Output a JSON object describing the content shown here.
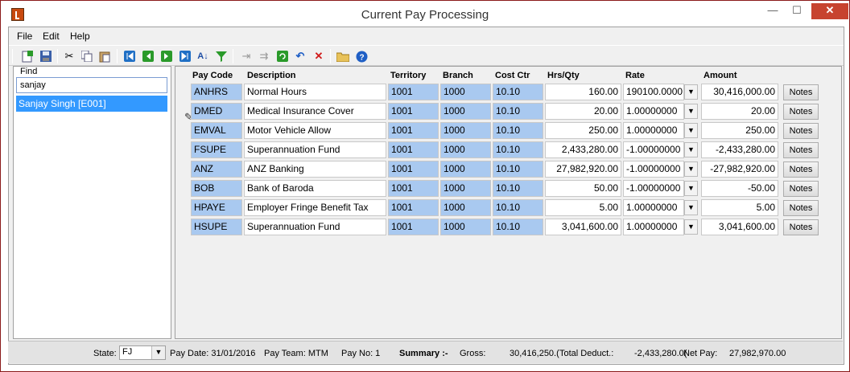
{
  "window": {
    "title": "Current Pay Processing",
    "min_glyph": "—",
    "max_glyph": "☐",
    "close_glyph": "✕"
  },
  "menu": {
    "file": "File",
    "edit": "Edit",
    "help": "Help"
  },
  "find": {
    "label": "Find",
    "value": "sanjay"
  },
  "employee": {
    "selected": "Sanjay  Singh [E001]"
  },
  "columns": {
    "pay_code": "Pay Code",
    "description": "Description",
    "territory": "Territory",
    "branch": "Branch",
    "cost_ctr": "Cost Ctr",
    "hrs_qty": "Hrs/Qty",
    "rate": "Rate",
    "amount": "Amount"
  },
  "rows": [
    {
      "code": "ANHRS",
      "desc": "Normal Hours",
      "territory": "1001",
      "branch": "1000",
      "cost": "10.10",
      "qty": "160.00",
      "rate": "190100.0000",
      "amount": "30,416,000.00",
      "notes": "Notes"
    },
    {
      "code": "DMED",
      "desc": "Medical Insurance Cover",
      "territory": "1001",
      "branch": "1000",
      "cost": "10.10",
      "qty": "20.00",
      "rate": "1.00000000",
      "amount": "20.00",
      "notes": "Notes"
    },
    {
      "code": "EMVAL",
      "desc": "Motor Vehicle Allow",
      "territory": "1001",
      "branch": "1000",
      "cost": "10.10",
      "qty": "250.00",
      "rate": "1.00000000",
      "amount": "250.00",
      "notes": "Notes"
    },
    {
      "code": "FSUPE",
      "desc": "Superannuation Fund",
      "territory": "1001",
      "branch": "1000",
      "cost": "10.10",
      "qty": "2,433,280.00",
      "rate": "-1.00000000",
      "amount": "-2,433,280.00",
      "notes": "Notes"
    },
    {
      "code": "ANZ",
      "desc": "ANZ Banking",
      "territory": "1001",
      "branch": "1000",
      "cost": "10.10",
      "qty": "27,982,920.00",
      "rate": "-1.00000000",
      "amount": "-27,982,920.00",
      "notes": "Notes"
    },
    {
      "code": "BOB",
      "desc": "Bank of Baroda",
      "territory": "1001",
      "branch": "1000",
      "cost": "10.10",
      "qty": "50.00",
      "rate": "-1.00000000",
      "amount": "-50.00",
      "notes": "Notes"
    },
    {
      "code": "HPAYE",
      "desc": "Employer Fringe Benefit Tax",
      "territory": "1001",
      "branch": "1000",
      "cost": "10.10",
      "qty": "5.00",
      "rate": "1.00000000",
      "amount": "5.00",
      "notes": "Notes"
    },
    {
      "code": "HSUPE",
      "desc": "Superannuation Fund",
      "territory": "1001",
      "branch": "1000",
      "cost": "10.10",
      "qty": "3,041,600.00",
      "rate": "1.00000000",
      "amount": "3,041,600.00",
      "notes": "Notes"
    }
  ],
  "status": {
    "state_label": "State:",
    "state_value": "FJ",
    "pay_date": "Pay Date:  31/01/2016",
    "pay_team": "Pay Team:  MTM",
    "pay_no": "Pay No:  1",
    "summary": "Summary :-",
    "gross_label": "Gross:",
    "gross_value": "30,416,250.(",
    "total_deduct": "Total Deduct.:",
    "deduct_value": "-2,433,280.0(",
    "net_pay": "Net Pay:",
    "net_value": "27,982,970.00"
  },
  "colors": {
    "border": "#8b1a1a",
    "selected": "#3399ff",
    "cell_blue": "#a9c9f0",
    "close_button": "#c7432f"
  }
}
